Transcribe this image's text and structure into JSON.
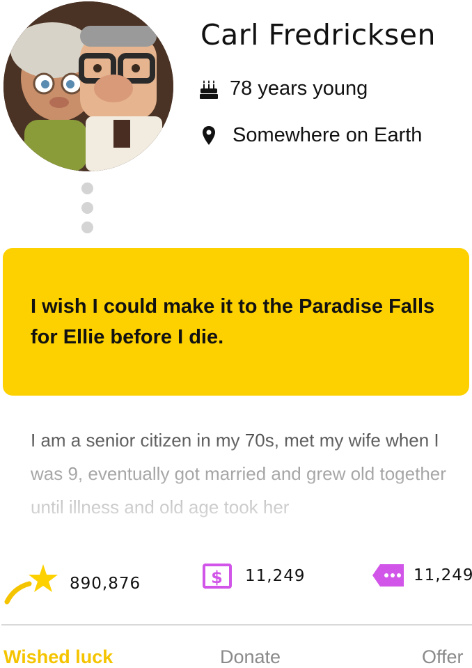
{
  "profile": {
    "name": "Carl Fredricksen",
    "age_text": "78 years young",
    "location_text": "Somewhere on Earth"
  },
  "wish": {
    "text": "I wish I could make it to the Paradise Falls for Ellie before I die."
  },
  "story": {
    "text": "I am a senior citizen in my 70s, met my wife when I was 9, eventually got married and grew old together until illness and old age took her"
  },
  "stats": {
    "luck_count": "890,876",
    "donate_count": "11,249",
    "offer_count": "11,249"
  },
  "tabs": {
    "wished_luck": "Wished luck",
    "donate": "Donate",
    "offer": "Offer"
  },
  "colors": {
    "accent_yellow": "#fdd100",
    "tab_active": "#f5c400",
    "purple": "#d155e8"
  },
  "icons": {
    "age": "birthday-cake-icon",
    "location": "map-pin-icon",
    "luck": "shooting-star-icon",
    "donate": "dollar-box-icon",
    "offer": "tag-icon"
  }
}
